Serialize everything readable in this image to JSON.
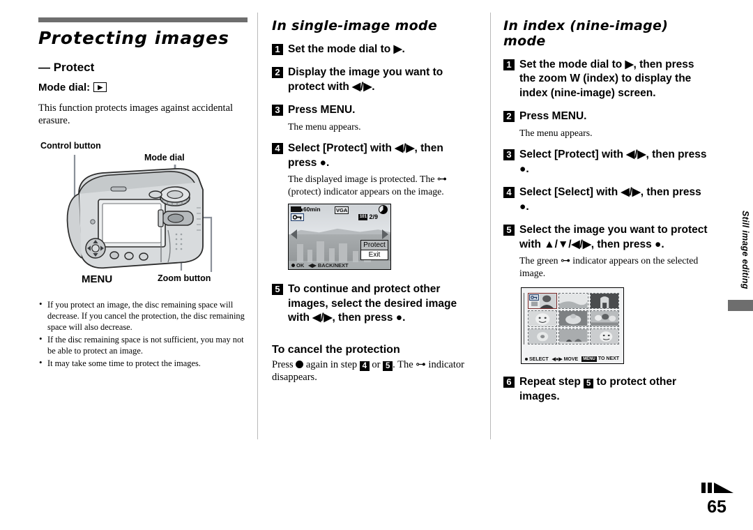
{
  "left": {
    "chapter_title": "Protecting images",
    "subtitle": "— Protect",
    "mode_dial_label": "Mode dial:",
    "mode_dial_icon": "playback-icon",
    "intro": "This function protects images against accidental erasure.",
    "figure": {
      "label_control_button": "Control button",
      "label_mode_dial": "Mode dial",
      "label_menu": "MENU",
      "label_zoom_button": "Zoom button"
    },
    "notes": [
      "If you protect an image, the disc remaining space will decrease. If you cancel the protection, the disc remaining space will also decrease.",
      "If the disc remaining space is not sufficient, you may not be able to protect an image.",
      "It may take some time to protect the images."
    ]
  },
  "middle": {
    "heading": "In single-image mode",
    "steps": [
      {
        "num": "1",
        "text": "Set the mode dial to ▶."
      },
      {
        "num": "2",
        "text": "Display the image you want to protect with ◀/▶."
      },
      {
        "num": "3",
        "text": "Press MENU.",
        "note": "The menu appears."
      },
      {
        "num": "4",
        "text": "Select [Protect] with ◀/▶, then press ●.",
        "note": "The displayed image is protected. The ⊶ (protect) indicator appears on the image."
      },
      {
        "num": "5",
        "text": "To continue and protect other images, select the desired image with ◀/▶, then press ●."
      }
    ],
    "lcd": {
      "battery_time": "60min",
      "quality": "VGA",
      "folder": "101",
      "counter": "2/9",
      "menu_items": [
        "Protect",
        "Exit"
      ],
      "bottom_ok": "OK",
      "bottom_nav": "BACK/NEXT"
    },
    "cancel_heading": "To cancel the protection",
    "cancel_text_a": "Press ",
    "cancel_text_b": " again in step ",
    "cancel_step_1": "4",
    "cancel_text_c": " or ",
    "cancel_step_2": "5",
    "cancel_text_d": ". The ⊶ indicator disappears."
  },
  "right": {
    "heading": "In index (nine-image) mode",
    "steps": [
      {
        "num": "1",
        "text": "Set the mode dial to ▶, then press the zoom W (index) to display the index (nine-image) screen."
      },
      {
        "num": "2",
        "text": "Press MENU.",
        "note": "The menu appears."
      },
      {
        "num": "3",
        "text": "Select [Protect] with ◀/▶, then press ●."
      },
      {
        "num": "4",
        "text": "Select [Select] with ◀/▶, then press ●."
      },
      {
        "num": "5",
        "text": "Select the image you want to protect with ▲/▼/◀/▶, then press ●.",
        "note": "The green ⊶ indicator appears on the selected image."
      },
      {
        "num": "6",
        "text": "Repeat step 5 to protect other images."
      }
    ],
    "index_screen": {
      "bottom_select": "SELECT",
      "bottom_move": "MOVE",
      "bottom_menu_chip": "MENU",
      "bottom_next": "TO NEXT"
    }
  },
  "side_tab": "Still image editing",
  "page_number": "65",
  "colors": {
    "rule_gray": "#6e6e6e",
    "divider_gray": "#b9b9b9",
    "leader_gray": "#8a9099"
  }
}
